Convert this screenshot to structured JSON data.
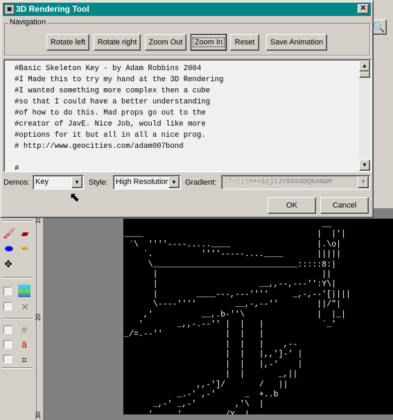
{
  "dialog": {
    "title": "3D Rendering Tool",
    "navigation": {
      "label": "Navigation",
      "buttons": [
        "Rotate left",
        "Rotate right",
        "Zoom Out",
        "Zoom In",
        "Reset",
        "Save Animation"
      ],
      "focused": "Zoom In"
    },
    "script_lines": [
      "#Basic Skeleton Key - by Adam Robbins 2004",
      "#I Made this to try my hand at the 3D Rendering",
      "#I wanted something more complex then a cube",
      "#so that I could have a better understanding",
      "#of how to do this. Mad props go out to the",
      "#creator of JavE. Nice Job, would like more",
      "#options for it but all in all a nice prog.",
      "# http://www.geocities.com/adam007bond",
      "",
      "#"
    ],
    "demos": {
      "label": "Demos:",
      "value": "Key"
    },
    "style": {
      "label": "Style:",
      "value": "High Resolution"
    },
    "gradient": {
      "label": "Gradient:",
      "value": " .'~:;!>+=icjtJY56SXDQKHNWM",
      "disabled": true
    },
    "ok": "OK",
    "cancel": "Cancel"
  },
  "ruler": {
    "labels": [
      "10",
      "20",
      "30"
    ]
  },
  "canvas": {
    "ascii": "                                         __\n____                                    |  |'|\n `\\  ''''----.....____                  |.\\o|\n    `.          ''''-----....____       |||||\n     \\______________________________:::::8:|\n      |                                  ||\n      |                     __,,--,---'':Y\\|\n      |        ____---,---''''     _,-,--'[||||\n      \\----''''        __,-,--''        ||/\"|\n    ,'          __,.b-''\\               |  |_|\n   '       _,,-.--'' |  |   |            `_'\n_/=.--''             |  |   |\n                     |  |   |    ,--\n                     |  |   |,,']-' |\n                     |  |   |,-'    |\n                     |  |       _,||\n               ,,-']/       /   ||\n           _.-' ,-'      _  +..b\n      _,-' _,-'        ,'\\  |\n   ,,'    .'         /Y  |  ,"
  },
  "colors": {
    "titlebar": "#008888",
    "canvas": "#000000",
    "workspace": "#808080"
  }
}
